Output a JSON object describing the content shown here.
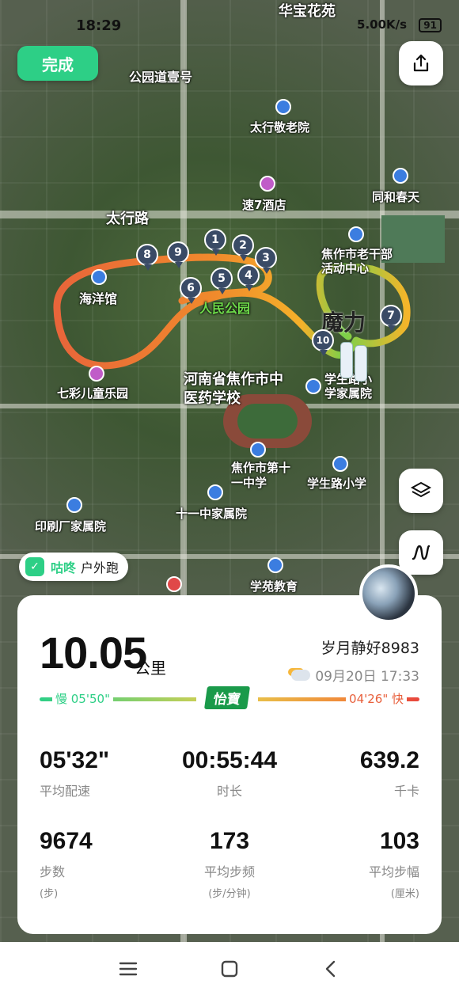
{
  "status_bar": {
    "time": "18:29",
    "network": "5.00K/s",
    "battery": "91"
  },
  "header": {
    "done_label": "完成"
  },
  "map": {
    "labels": {
      "park_road": "公园道壹号",
      "nursing_home": "太行敬老院",
      "hotel": "速7酒店",
      "tonghe": "同和春天",
      "taihang_road": "太行路",
      "ocean_hall": "海洋馆",
      "peoples_park": "人民公园",
      "elderly_center": "焦作市老干部活动中心",
      "kids_park": "七彩儿童乐园",
      "tcm_school": "河南省焦作市中医药学校",
      "xuesheng_primary": "学生路小学家属院",
      "no11_school": "焦作市第十一中学",
      "xuesheng_school": "学生路小学",
      "no11_family": "十一中家属院",
      "printing_family": "印刷厂家属院",
      "xueyuan": "学苑教育",
      "mofa": "魔力",
      "huabao": "华宝花苑"
    },
    "markers": [
      "1",
      "2",
      "3",
      "4",
      "5",
      "6",
      "7",
      "8",
      "9",
      "10"
    ]
  },
  "brand": {
    "name": "咕咚",
    "mode": "户外跑"
  },
  "summary": {
    "distance": "10.05",
    "distance_unit": "公里",
    "username": "岁月静好8983",
    "date": "09月20日 17:33",
    "pace_slow": "慢 05'50\"",
    "pace_fast": "04'26\" 快",
    "sponsor": "怡寶"
  },
  "stats": {
    "avg_pace": {
      "value": "05'32\"",
      "label": "平均配速"
    },
    "duration": {
      "value": "00:55:44",
      "label": "时长"
    },
    "calories": {
      "value": "639.2",
      "label": "千卡"
    },
    "steps": {
      "value": "9674",
      "label": "步数",
      "unit": "(步)"
    },
    "cadence": {
      "value": "173",
      "label": "平均步频",
      "unit": "(步/分钟)"
    },
    "stride": {
      "value": "103",
      "label": "平均步幅",
      "unit": "(厘米)"
    }
  }
}
